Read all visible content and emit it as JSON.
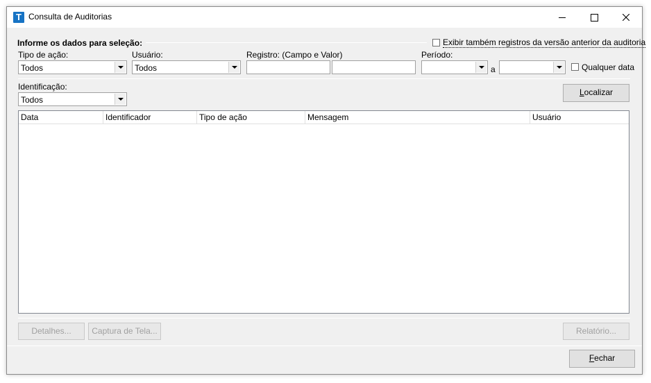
{
  "window": {
    "title": "Consulta de Auditorias",
    "app_icon_letter": "T"
  },
  "group": {
    "title": "Informe os dados para seleção:"
  },
  "show_previous": {
    "label": "Exibir também registros da versão anterior da auditoria",
    "checked": false
  },
  "filters": {
    "action_type": {
      "label": "Tipo de ação:",
      "value": "Todos"
    },
    "user": {
      "label": "Usuário:",
      "value": "Todos"
    },
    "record": {
      "label": "Registro: (Campo e Valor)",
      "field_value": "",
      "value_value": ""
    },
    "period": {
      "label": "Período:",
      "from": "",
      "separator": "a",
      "to": "",
      "any_date_label": "Qualquer data",
      "any_date_checked": false
    },
    "identification": {
      "label": "Identificação:",
      "value": "Todos"
    }
  },
  "buttons": {
    "search": {
      "accel": "L",
      "rest": "ocalizar"
    },
    "details": "Detalhes...",
    "screenshot": "Captura de Tela...",
    "report": "Relatório...",
    "close": {
      "accel": "F",
      "rest": "echar"
    }
  },
  "table": {
    "columns": [
      "Data",
      "Identificador",
      "Tipo de ação",
      "Mensagem",
      "Usuário"
    ],
    "rows": []
  }
}
